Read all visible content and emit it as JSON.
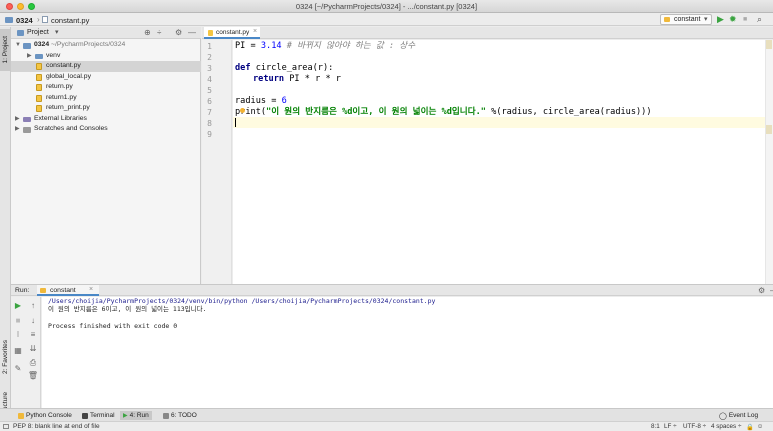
{
  "window": {
    "title": "0324 [~/PycharmProjects/0324] - .../constant.py [0324]"
  },
  "navbar": {
    "project": "0324",
    "file": "constant.py",
    "run_config": "constant"
  },
  "sidebar_tabs": {
    "project": "1: Project",
    "favorites": "2: Favorites",
    "structure": "Z: Structure"
  },
  "project_panel": {
    "header": "Project",
    "tree": [
      {
        "label": "0324",
        "path": "~/PycharmProjects/0324",
        "kind": "folder",
        "depth": 0,
        "expanded": true
      },
      {
        "label": "venv",
        "kind": "folder",
        "depth": 1,
        "expanded": false
      },
      {
        "label": "constant.py",
        "kind": "py",
        "depth": 1,
        "selected": true
      },
      {
        "label": "global_local.py",
        "kind": "py",
        "depth": 1
      },
      {
        "label": "return.py",
        "kind": "py",
        "depth": 1
      },
      {
        "label": "return1.py",
        "kind": "py",
        "depth": 1
      },
      {
        "label": "return_print.py",
        "kind": "py",
        "depth": 1
      },
      {
        "label": "External Libraries",
        "kind": "lib",
        "depth": 0,
        "expanded": false
      },
      {
        "label": "Scratches and Consoles",
        "kind": "scratch",
        "depth": 0,
        "expanded": false
      }
    ]
  },
  "editor": {
    "tab": "constant.py",
    "line_numbers": [
      "1",
      "2",
      "3",
      "4",
      "5",
      "6",
      "7",
      "8",
      "9"
    ],
    "code": {
      "l1_var": "PI = ",
      "l1_num": "3.14",
      "l1_cmt": " # 바뀌지 않아야 하는 값 : 상수",
      "l3_kw": "def",
      "l3_rest": " circle_area(r):",
      "l4_kw": "return",
      "l4_rest": " PI * r * r",
      "l6_var": "radius = ",
      "l6_num": "6",
      "l7_fn": "print(",
      "l7_str": "\"이 원의 반지름은 %d이고, 이 원의 넓이는 %d입니다.\"",
      "l7_rest": " %(radius, circle_area(radius)))"
    }
  },
  "run_panel": {
    "label": "Run:",
    "tab": "constant",
    "output": [
      "/Users/choijia/PycharmProjects/0324/venv/bin/python /Users/choijia/PycharmProjects/0324/constant.py",
      "이 원의 반지름은 6이고, 이 원의 넓이는 113입니다.",
      "",
      "Process finished with exit code 0"
    ]
  },
  "bottom_tools": {
    "python_console": "Python Console",
    "terminal": "Terminal",
    "run": "4: Run",
    "todo": "6: TODO",
    "event_log": "Event Log"
  },
  "status": {
    "message": "PEP 8: blank line at end of file",
    "position": "8:1",
    "line_sep": "LF ÷",
    "encoding": "UTF-8 ÷",
    "indent": "4 spaces ÷"
  }
}
